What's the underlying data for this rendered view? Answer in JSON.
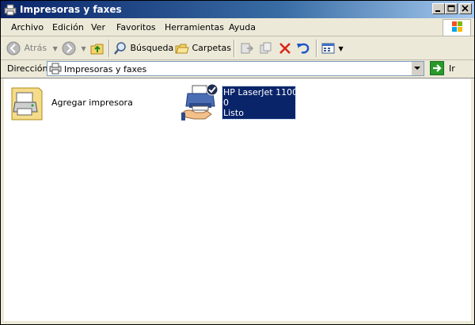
{
  "window": {
    "title": "Impresoras y faxes"
  },
  "menu": [
    "Archivo",
    "Edición",
    "Ver",
    "Favoritos",
    "Herramientas",
    "Ayuda"
  ],
  "toolbar": {
    "back": "Atrás",
    "search": "Búsqueda",
    "folders": "Carpetas"
  },
  "address": {
    "label": "Dirección",
    "value": "Impresoras y faxes",
    "go": "Ir"
  },
  "items": {
    "add_printer": "Agregar impresora",
    "printer": {
      "name": "HP LaserJet 1100",
      "docs": "0",
      "status": "Listo"
    }
  },
  "colors": {
    "title_start": "#0a246a",
    "title_end": "#a6caf0",
    "selection": "#0a246a",
    "chrome": "#ece9d8"
  }
}
